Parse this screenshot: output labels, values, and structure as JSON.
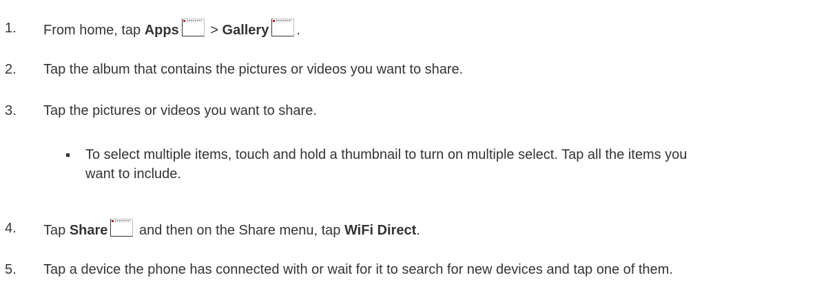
{
  "steps": [
    {
      "num": "1.",
      "t1": "From home, tap ",
      "b1": "Apps",
      "t2": " > ",
      "b2": "Gallery",
      "t3": "."
    },
    {
      "num": "2.",
      "text": "Tap the album that contains the pictures or videos you want to share."
    },
    {
      "num": "3.",
      "text": "Tap the pictures or videos you want to share."
    },
    {
      "num": "4.",
      "t1": "Tap ",
      "b1": "Share",
      "t2": " and then on the Share menu, tap ",
      "b2": "WiFi Direct",
      "t3": "."
    },
    {
      "num": "5.",
      "text": "Tap a device the phone has connected with or wait for it to search for new devices and tap one of them."
    }
  ],
  "sub_bullet": {
    "text": "To select multiple items, touch and hold a thumbnail to turn on multiple select. Tap all the items you want to include."
  },
  "icons": [
    "apps-icon",
    "gallery-icon",
    "share-icon"
  ]
}
